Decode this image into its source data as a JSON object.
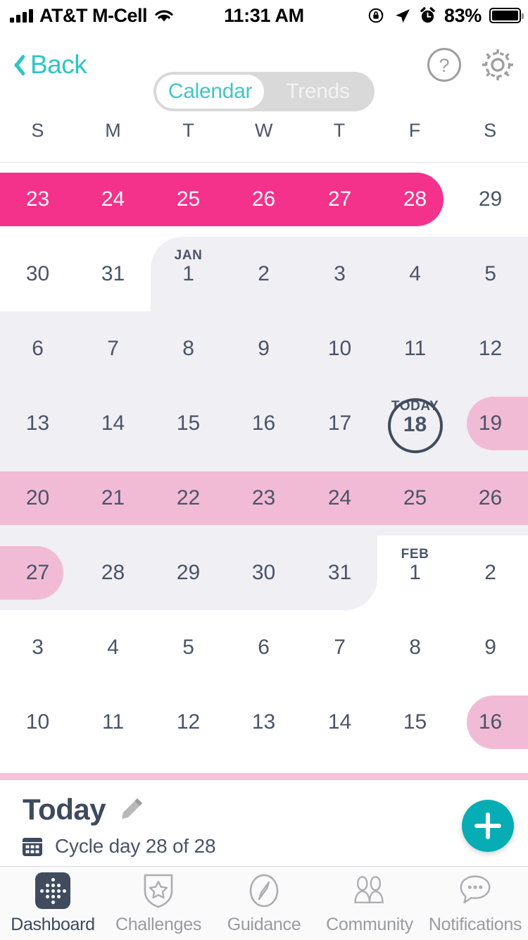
{
  "statusbar": {
    "carrier": "AT&T M-Cell",
    "time": "11:31 AM",
    "battery_pct": "83%",
    "icons": [
      "signal-icon",
      "wifi-icon",
      "rotation-lock-icon",
      "location-arrow-icon",
      "alarm-clock-icon",
      "battery-icon"
    ]
  },
  "navbar": {
    "back_label": "Back",
    "segments": [
      {
        "label": "Calendar",
        "active": true
      },
      {
        "label": "Trends",
        "active": false
      }
    ],
    "help_icon": "question-mark-circle-icon",
    "settings_icon": "gear-icon"
  },
  "calendar": {
    "weekdays": [
      "S",
      "M",
      "T",
      "W",
      "T",
      "F",
      "S"
    ],
    "today_label": "TODAY",
    "month_labels": {
      "jan": "JAN",
      "feb": "FEB"
    },
    "rows": [
      {
        "days": [
          "23",
          "24",
          "25",
          "26",
          "27",
          "28",
          "29"
        ]
      },
      {
        "days": [
          "30",
          "31",
          "1",
          "2",
          "3",
          "4",
          "5"
        ]
      },
      {
        "days": [
          "6",
          "7",
          "8",
          "9",
          "10",
          "11",
          "12"
        ]
      },
      {
        "days": [
          "13",
          "14",
          "15",
          "16",
          "17",
          "18",
          "19"
        ]
      },
      {
        "days": [
          "20",
          "21",
          "22",
          "23",
          "24",
          "25",
          "26"
        ]
      },
      {
        "days": [
          "27",
          "28",
          "29",
          "30",
          "31",
          "1",
          "2"
        ]
      },
      {
        "days": [
          "3",
          "4",
          "5",
          "6",
          "7",
          "8",
          "9"
        ]
      },
      {
        "days": [
          "10",
          "11",
          "12",
          "13",
          "14",
          "15",
          "16"
        ]
      }
    ],
    "today": {
      "row": 3,
      "col": 5,
      "day": "18"
    },
    "colors": {
      "period_hot": "#F4318B",
      "period_soft": "#F2BBD5",
      "month_bg": "#F0EFF4",
      "text": "#4A5468"
    }
  },
  "today_panel": {
    "title": "Today",
    "edit_icon": "pencil-icon",
    "cycle_icon": "calendar-icon",
    "cycle_text": "Cycle day 28 of 28",
    "add_button_icon": "plus-icon",
    "accent": "#06ADB5"
  },
  "tabbar": {
    "tabs": [
      {
        "label": "Dashboard",
        "icon": "dashboard-dots-icon",
        "active": true
      },
      {
        "label": "Challenges",
        "icon": "star-shield-icon",
        "active": false
      },
      {
        "label": "Guidance",
        "icon": "compass-icon",
        "active": false
      },
      {
        "label": "Community",
        "icon": "people-icon",
        "active": false
      },
      {
        "label": "Notifications",
        "icon": "chat-bubble-icon",
        "active": false
      }
    ]
  }
}
